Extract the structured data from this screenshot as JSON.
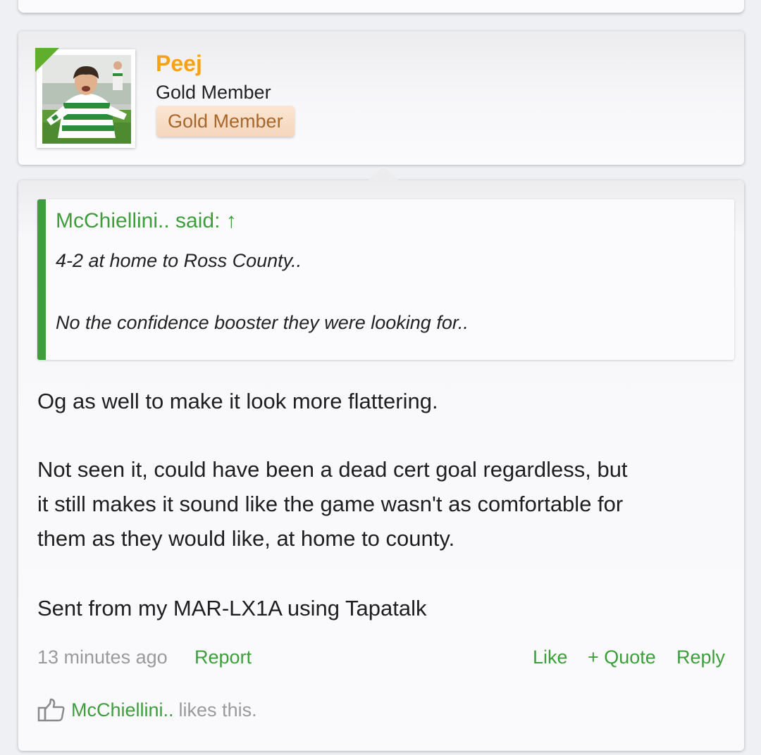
{
  "author": {
    "username": "Peej",
    "user_title": "Gold Member",
    "banner": "Gold Member",
    "accent": "#f5a316"
  },
  "quote": {
    "attribution": "McChiellini.. said: ↑",
    "lines": [
      "4-2 at home to Ross County..",
      "No the confidence booster they were looking for.."
    ]
  },
  "post": {
    "lines": [
      "Og as well to make it look more flattering.",
      "Not seen it, could have been a dead cert goal regardless, but",
      "it still makes it sound like the game wasn't as comfortable for",
      "them as they would like, at home to county.",
      "Sent from my MAR-LX1A using Tapatalk"
    ]
  },
  "meta": {
    "time": "13 minutes ago",
    "report": "Report",
    "like": "Like",
    "quote": "+ Quote",
    "reply": "Reply"
  },
  "likes": {
    "user": "McChiellini..",
    "suffix": "likes this."
  },
  "colors": {
    "link": "#3d9e3b",
    "banner_text": "#a8672a",
    "muted": "#9a9a9a"
  },
  "icons": {
    "thumbs_up": "thumbs-up-icon",
    "avatar_corner": "online-indicator"
  }
}
